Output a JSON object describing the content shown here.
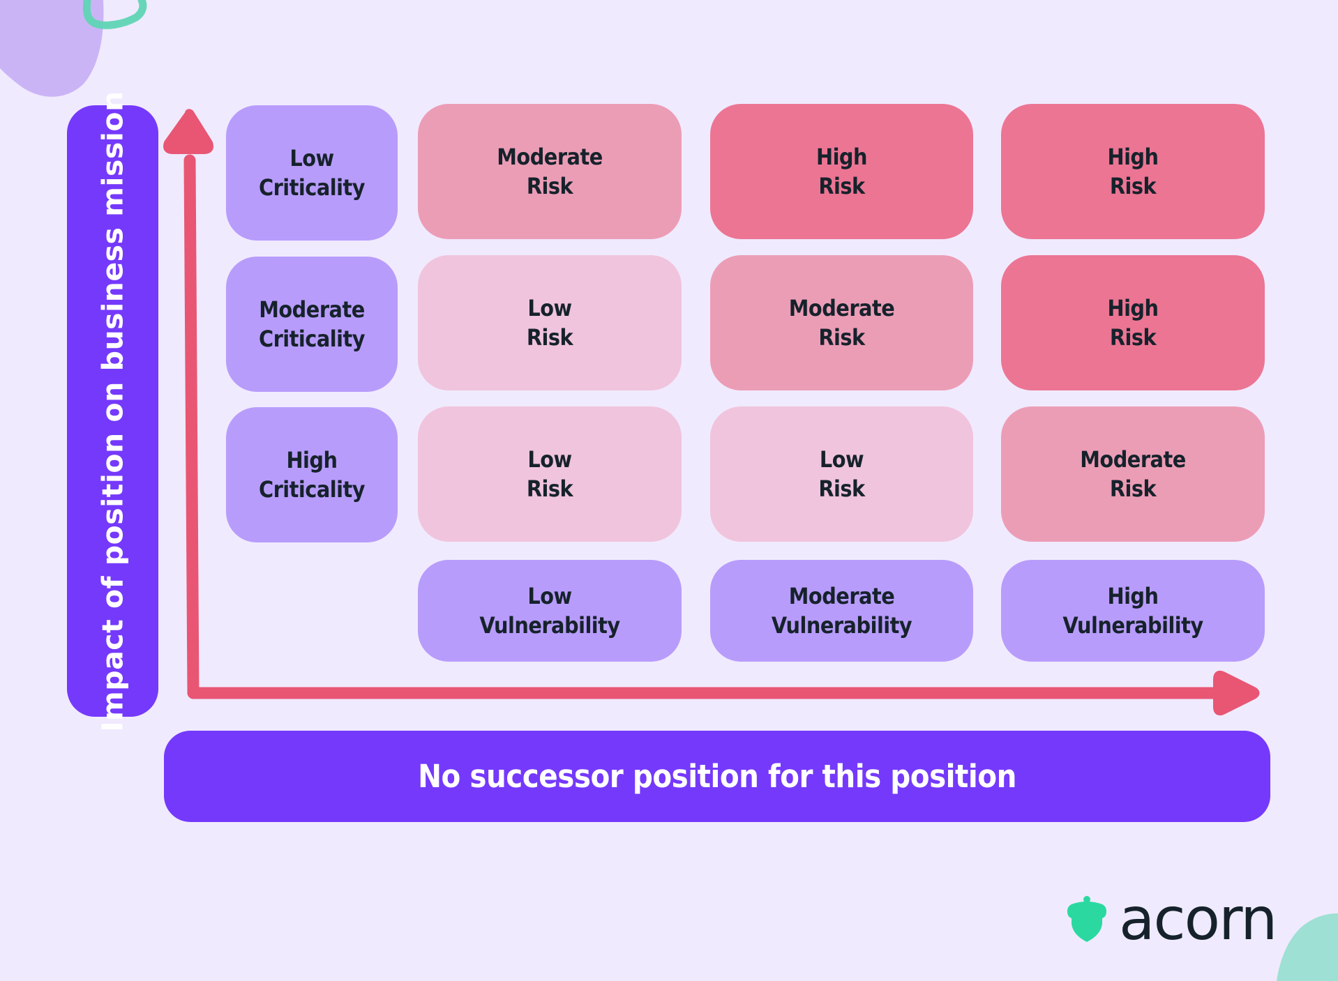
{
  "colors": {
    "background": "#f0eafe",
    "axis_label_box": "#7539fc",
    "axis_arrow": "#e85674",
    "header_cell": "#b89cfb",
    "low_risk": "#f0c4dc",
    "moderate_risk": "#ec9db6",
    "high_risk": "#ec7594",
    "brand_green": "#2bd9a0",
    "text_dark": "#16222b"
  },
  "y_axis_label": "Impact of position on business mission",
  "x_axis_label": "No successor position for this position",
  "criticality_levels": [
    {
      "line1": "Low",
      "line2": "Criticality"
    },
    {
      "line1": "Moderate",
      "line2": "Criticality"
    },
    {
      "line1": "High",
      "line2": "Criticality"
    }
  ],
  "vulnerability_levels": [
    {
      "line1": "Low",
      "line2": "Vulnerability"
    },
    {
      "line1": "Moderate",
      "line2": "Vulnerability"
    },
    {
      "line1": "High",
      "line2": "Vulnerability"
    }
  ],
  "risk_matrix": [
    [
      {
        "line1": "Moderate",
        "line2": "Risk",
        "level": "moderate"
      },
      {
        "line1": "High",
        "line2": "Risk",
        "level": "high"
      },
      {
        "line1": "High",
        "line2": "Risk",
        "level": "high"
      }
    ],
    [
      {
        "line1": "Low",
        "line2": "Risk",
        "level": "low"
      },
      {
        "line1": "Moderate",
        "line2": "Risk",
        "level": "moderate"
      },
      {
        "line1": "High",
        "line2": "Risk",
        "level": "high"
      }
    ],
    [
      {
        "line1": "Low",
        "line2": "Risk",
        "level": "low"
      },
      {
        "line1": "Low",
        "line2": "Risk",
        "level": "low"
      },
      {
        "line1": "Moderate",
        "line2": "Risk",
        "level": "moderate"
      }
    ]
  ],
  "brand": {
    "name": "acorn",
    "logo_icon": "acorn-icon"
  }
}
